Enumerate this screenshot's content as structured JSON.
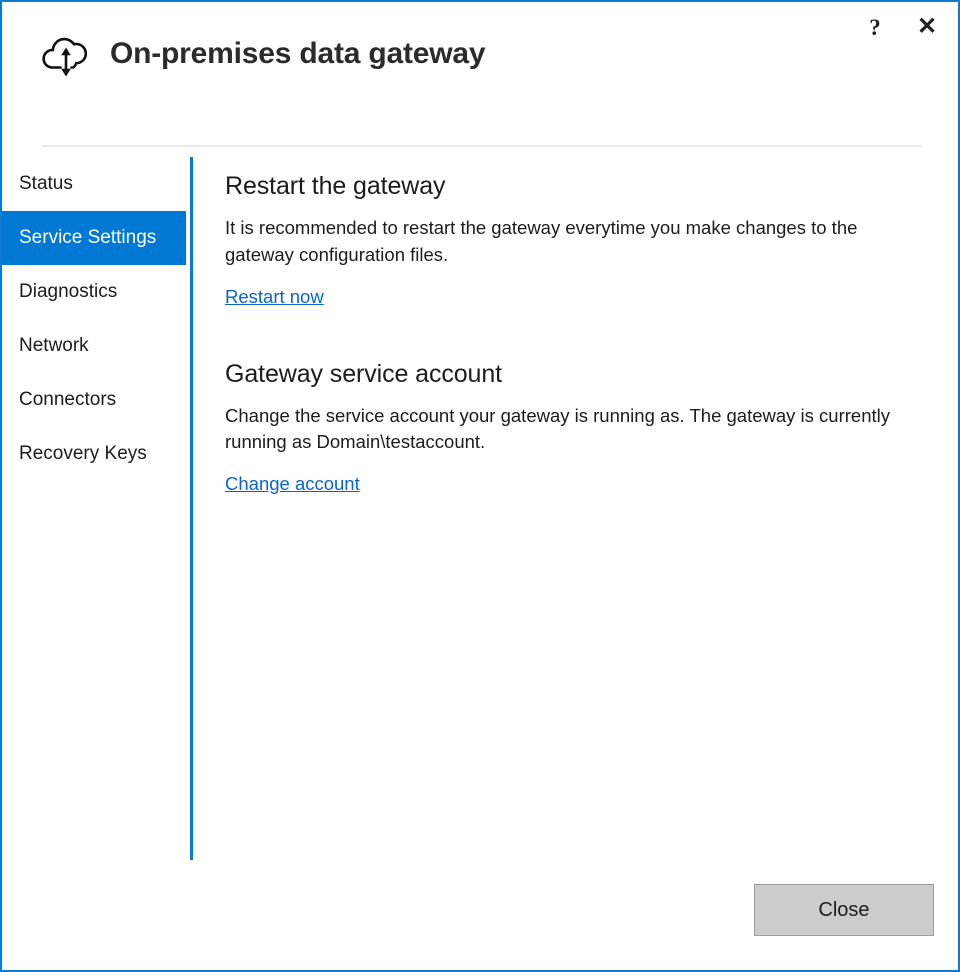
{
  "window": {
    "title": "On-premises data gateway",
    "app_icon": "cloud-updown-arrow-icon",
    "border_color": "#0b7ad4"
  },
  "titlebar": {
    "help_label": "?",
    "help_icon": "question-mark-icon",
    "close_label": "✕",
    "close_icon": "close-x-icon"
  },
  "sidebar": {
    "selected_color": "#0078d4",
    "items": [
      {
        "label": "Status",
        "selected": false
      },
      {
        "label": "Service Settings",
        "selected": true
      },
      {
        "label": "Diagnostics",
        "selected": false
      },
      {
        "label": "Network",
        "selected": false
      },
      {
        "label": "Connectors",
        "selected": false
      },
      {
        "label": "Recovery Keys",
        "selected": false
      }
    ]
  },
  "main": {
    "sections": [
      {
        "title": "Restart the gateway",
        "body": "It is recommended to restart the gateway everytime you make changes to the gateway configuration files.",
        "link": "Restart now"
      },
      {
        "title": "Gateway service account",
        "body": "Change the service account your gateway is running as. The gateway is currently running as Domain\\testaccount.",
        "link": "Change account"
      }
    ],
    "link_color": "#0d64c8"
  },
  "footer": {
    "close_button_label": "Close",
    "close_button_fill": "#cccccc",
    "close_button_border": "#9c9c9c"
  }
}
